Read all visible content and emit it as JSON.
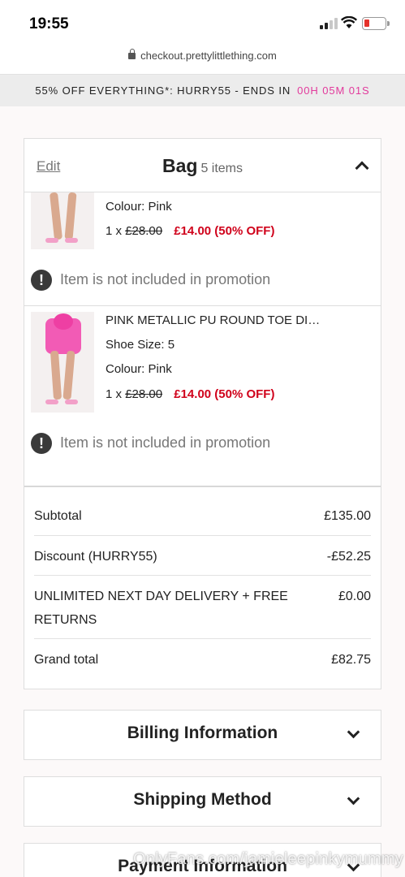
{
  "status_bar": {
    "time": "19:55"
  },
  "browser": {
    "url": "checkout.prettylittlething.com"
  },
  "promo": {
    "text": "55% OFF EVERYTHING*: HURRY55 - ENDS IN",
    "countdown": "00H 05M 01S"
  },
  "bag": {
    "edit_label": "Edit",
    "title": "Bag",
    "count_label": "5 items",
    "items": [
      {
        "name": "",
        "colour": "Colour: Pink",
        "qty": "1 x",
        "old_price": "£28.00",
        "new_price": "£14.00 (50% OFF)",
        "notice": "Item is not included in promotion"
      },
      {
        "name": "PINK METALLIC PU ROUND TOE DI…",
        "size": "Shoe Size: 5",
        "colour": "Colour: Pink",
        "qty": "1 x",
        "old_price": "£28.00",
        "new_price": "£14.00 (50% OFF)",
        "notice": "Item is not included in promotion"
      }
    ]
  },
  "summary": {
    "subtotal_label": "Subtotal",
    "subtotal_value": "£135.00",
    "discount_label": "Discount (HURRY55)",
    "discount_value": "-£52.25",
    "delivery_label_1": "UNLIMITED NEXT DAY DELIVERY + FREE",
    "delivery_label_2": "RETURNS",
    "delivery_value": "£0.00",
    "grand_total_label": "Grand total",
    "grand_total_value": "£82.75"
  },
  "sections": {
    "billing": "Billing Information",
    "shipping": "Shipping Method",
    "payment": "Payment Information"
  },
  "watermark": "OnlyFans.com/jamieleepinkymummy",
  "colors": {
    "accent_pink": "#e23a9c",
    "sale_red": "#d0021b"
  }
}
